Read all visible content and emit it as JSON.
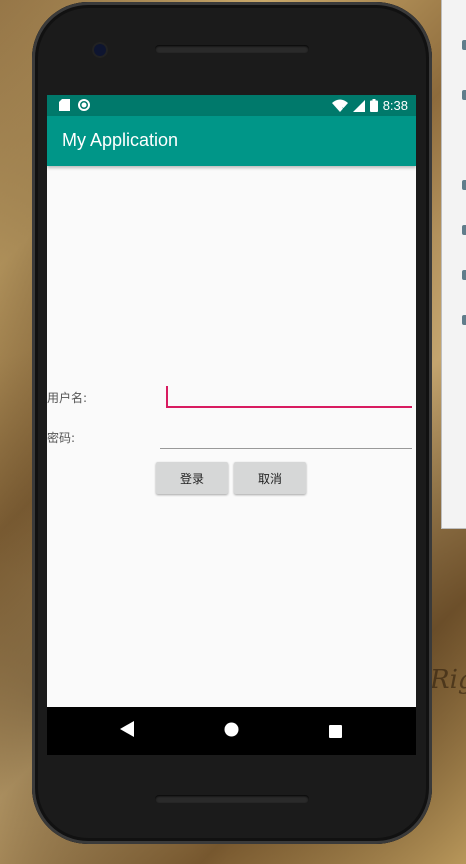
{
  "app": {
    "title": "My Application"
  },
  "status_bar": {
    "time": "8:38",
    "left_icons": [
      "sd-card-icon",
      "circle-status-icon"
    ],
    "right_icons": [
      "wifi-icon",
      "cellular-signal-icon",
      "battery-icon"
    ],
    "background": "#00796b"
  },
  "app_bar": {
    "background": "#009688"
  },
  "form": {
    "username_label": "用户名:",
    "password_label": "密码:",
    "username_value": "",
    "password_value": "",
    "login_button": "登录",
    "cancel_button": "取消",
    "accent_color": "#d81b60"
  },
  "nav_bar": {
    "back_icon": "back-triangle-icon",
    "home_icon": "home-circle-icon",
    "recents_icon": "recents-square-icon"
  },
  "background_text": {
    "bottom_right": "Rig"
  }
}
